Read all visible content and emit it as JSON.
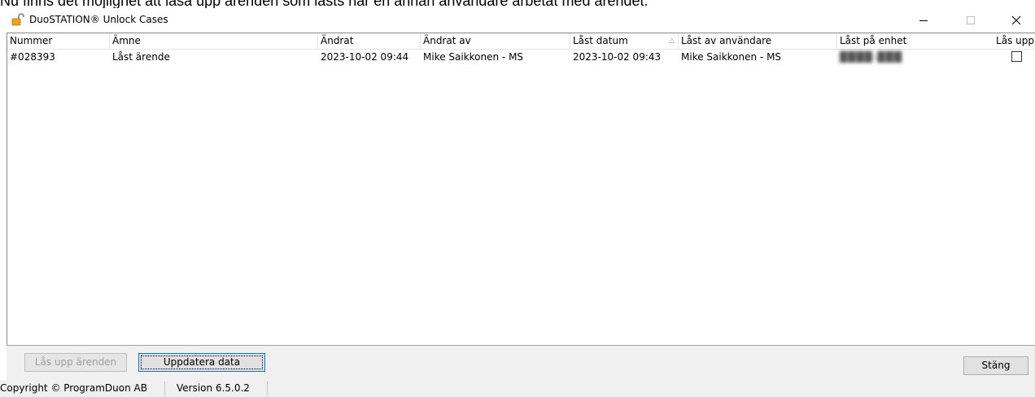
{
  "document_caption": "Nu finns det möjlighet att låsa upp ärenden som låsts när en annan användare arbetat med ärendet.",
  "window": {
    "title": "DuoSTATION® Unlock Cases",
    "icon": "unlocked-padlock-icon",
    "controls": {
      "minimize": "–",
      "maximize": "□",
      "close": "✕"
    }
  },
  "table": {
    "columns": [
      {
        "key": "nummer",
        "label": "Nummer"
      },
      {
        "key": "amne",
        "label": "Ämne"
      },
      {
        "key": "andrat",
        "label": "Ändrat"
      },
      {
        "key": "andrat_av",
        "label": "Ändrat av"
      },
      {
        "key": "last_datum",
        "label": "Låst datum",
        "sorted": "ascending",
        "sort_glyph": "△"
      },
      {
        "key": "last_av_anvandare",
        "label": "Låst av användare"
      },
      {
        "key": "last_pa_enhet",
        "label": "Låst på enhet"
      },
      {
        "key": "las_upp",
        "label": "Lås upp"
      }
    ],
    "rows": [
      {
        "nummer": "#028393",
        "amne": "Låst ärende",
        "andrat": "2023-10-02 09:44",
        "andrat_av": "Mike Saikkonen - MS",
        "last_datum": "2023-10-02 09:43",
        "last_av_anvandare": "Mike Saikkonen - MS",
        "last_pa_enhet": "████-███",
        "las_upp_checked": false
      }
    ]
  },
  "buttons": {
    "unlock": {
      "label": "Lås upp ärenden",
      "enabled": false
    },
    "refresh": {
      "label": "Uppdatera data",
      "enabled": true
    },
    "close": {
      "label": "Stäng",
      "enabled": true
    }
  },
  "statusbar": {
    "copyright": "Copyright © ProgramDuon AB",
    "version": "Version 6.5.0.2"
  },
  "colors": {
    "icon_lock_body": "#e8a317",
    "focus_border": "#0078d7",
    "panel_bg": "#f0f0f0"
  }
}
